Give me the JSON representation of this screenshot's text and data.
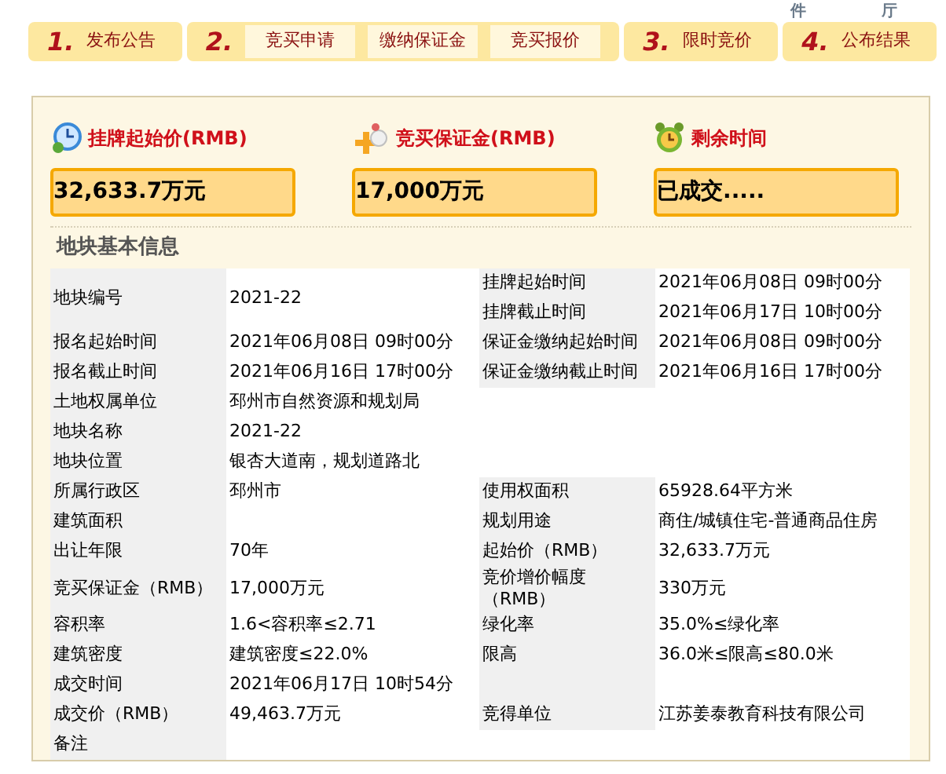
{
  "top_fragments": [
    "件",
    "厅"
  ],
  "steps": [
    {
      "number": "1.",
      "label": "发布公告"
    },
    {
      "number": "2.",
      "substeps": [
        "竞买申请",
        "缴纳保证金",
        "竞买报价"
      ]
    },
    {
      "number": "3.",
      "label": "限时竞价"
    },
    {
      "number": "4.",
      "label": "公布结果"
    }
  ],
  "summary": [
    {
      "kind": "clock",
      "title": "挂牌起始价(RMB)",
      "value": "32,633.7万元"
    },
    {
      "kind": "coins",
      "title": "竞买保证金(RMB)",
      "value": "17,000万元"
    },
    {
      "kind": "alarm",
      "title": "剩余时间",
      "value": "已成交....."
    }
  ],
  "section_title": "地块基本信息",
  "rows": [
    {
      "kind": "double",
      "label": "地块编号",
      "value": "2021-22",
      "right": [
        {
          "label": "挂牌起始时间",
          "value": "2021年06月08日 09时00分"
        },
        {
          "label": "挂牌截止时间",
          "value": "2021年06月17日 10时00分"
        }
      ]
    },
    {
      "kind": "pair",
      "label": "报名起始时间",
      "value": "2021年06月08日 09时00分",
      "right": [
        {
          "label": "保证金缴纳起始时间",
          "value": "2021年06月08日 09时00分"
        }
      ]
    },
    {
      "kind": "pair",
      "label": "报名截止时间",
      "value": "2021年06月16日 17时00分",
      "right": [
        {
          "label": "保证金缴纳截止时间",
          "value": "2021年06月16日 17时00分"
        }
      ]
    },
    {
      "kind": "left",
      "label": "土地权属单位",
      "value": "邳州市自然资源和规划局"
    },
    {
      "kind": "left",
      "label": "地块名称",
      "value": "2021-22"
    },
    {
      "kind": "left",
      "label": "地块位置",
      "value": "银杏大道南，规划道路北"
    },
    {
      "kind": "pair",
      "label": "所属行政区",
      "value": "邳州市",
      "right": [
        {
          "label": "使用权面积",
          "value": "65928.64平方米"
        }
      ]
    },
    {
      "kind": "pair",
      "label": "建筑面积",
      "right": [
        {
          "label": "规划用途",
          "value": "商住/城镇住宅-普通商品住房"
        }
      ]
    },
    {
      "kind": "pair",
      "label": "出让年限",
      "value": "70年",
      "right": [
        {
          "label": "起始价（RMB）",
          "value": "32,633.7万元"
        }
      ]
    },
    {
      "kind": "pair",
      "label": "竞买保证金（RMB）",
      "value": "17,000万元",
      "right": [
        {
          "label": "竞价增价幅度（RMB）",
          "value": "330万元"
        }
      ]
    },
    {
      "kind": "pair",
      "label": "容积率",
      "value": "1.6<容积率≤2.71",
      "right": [
        {
          "label": "绿化率",
          "value": "35.0%≤绿化率"
        }
      ]
    },
    {
      "kind": "pair",
      "label": "建筑密度",
      "value": "建筑密度≤22.0%",
      "right": [
        {
          "label": "限高",
          "value": "36.0米≤限高≤80.0米"
        }
      ]
    },
    {
      "kind": "blank_right",
      "label": "成交时间",
      "value": "2021年06月17日 10时54分"
    },
    {
      "kind": "pair",
      "label": "成交价（RMB）",
      "value": "49,463.7万元",
      "right": [
        {
          "label": "竞得单位",
          "value": "江苏姜泰教育科技有限公司"
        }
      ]
    },
    {
      "kind": "note",
      "label": "备注"
    }
  ]
}
